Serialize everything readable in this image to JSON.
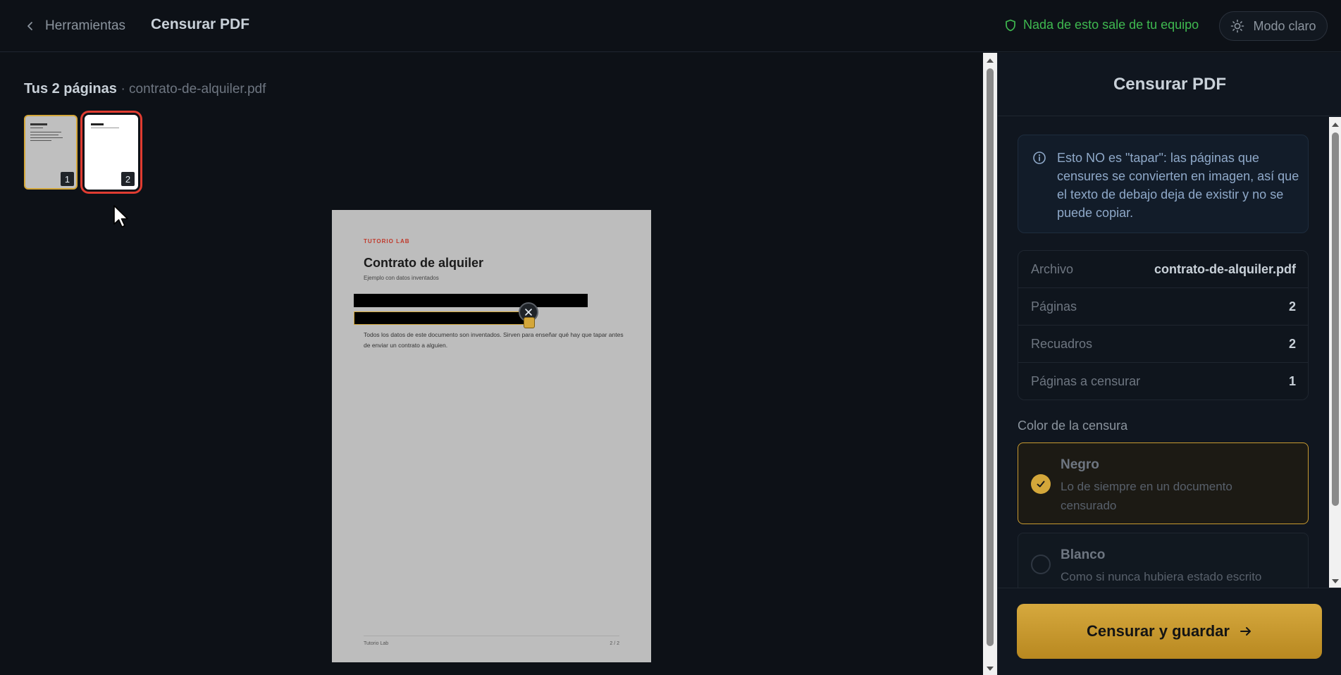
{
  "header": {
    "back_label": "Herramientas",
    "title": "Censurar PDF",
    "privacy_note": "Nada de esto sale de tu equipo",
    "theme_toggle_label": "Modo claro"
  },
  "main": {
    "pages_count_label": "Tus 2 páginas",
    "file_separator_name": "· contrato-de-alquiler.pdf",
    "thumbnails": [
      {
        "number": "1",
        "selected": false
      },
      {
        "number": "2",
        "selected": true
      }
    ],
    "page_preview": {
      "brand": "TUTORIO LAB",
      "title": "Contrato de alquiler",
      "subtitle": "Ejemplo con datos inventados",
      "body": "Todos los datos de este documento son inventados. Sirven para enseñar qué hay que tapar antes de enviar un contrato a alguien.",
      "footer_left": "Tutorio Lab",
      "footer_right": "2 / 2"
    }
  },
  "panel": {
    "title": "Censurar PDF",
    "info_text": "Esto NO es \"tapar\": las páginas que censures se convierten en imagen, así que el texto de debajo deja de existir y no se puede copiar.",
    "stats": [
      {
        "key": "Archivo",
        "value": "contrato-de-alquiler.pdf"
      },
      {
        "key": "Páginas",
        "value": "2"
      },
      {
        "key": "Recuadros",
        "value": "2"
      },
      {
        "key": "Páginas a censurar",
        "value": "1"
      }
    ],
    "color_label": "Color de la censura",
    "color_options": [
      {
        "name": "Negro",
        "description": "Lo de siempre en un documento censurado",
        "selected": true
      },
      {
        "name": "Blanco",
        "description": "Como si nunca hubiera estado escrito",
        "selected": false
      }
    ],
    "cta_label": "Censurar y guardar"
  },
  "colors": {
    "accent": "#d4a73a",
    "background": "#0d1117",
    "privacy_green": "#3fb950",
    "selection_red": "#e03c31"
  }
}
